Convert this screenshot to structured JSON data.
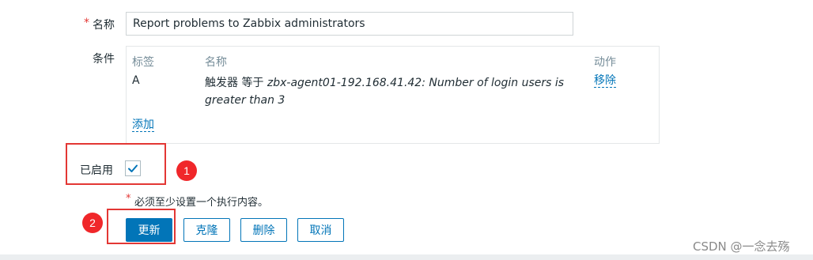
{
  "form": {
    "name_required_mark": "*",
    "name_label": "名称",
    "name_value": "Report problems to Zabbix administrators",
    "conditions_label": "条件",
    "conditions": {
      "header_label": "标签",
      "header_name": "名称",
      "header_action": "动作",
      "rows": [
        {
          "label": "A",
          "prefix": "触发器 等于 ",
          "value_line1": "zbx-agent01-192.168.41.42: Number of login users is",
          "value_line2": "greater than 3",
          "action": "移除"
        }
      ],
      "add_link": "添加"
    },
    "enabled_label": "已启用",
    "enabled_checked": true,
    "note_mark": "*",
    "note_text": "必须至少设置一个执行内容。"
  },
  "buttons": {
    "update": "更新",
    "clone": "克隆",
    "delete": "删除",
    "cancel": "取消"
  },
  "annotations": {
    "badge1": "1",
    "badge2": "2",
    "highlight_color": "#e33734"
  },
  "watermark": "CSDN @一念去殇",
  "colors": {
    "primary": "#0275b8",
    "text": "#1f2c33",
    "header_text": "#768d99"
  }
}
